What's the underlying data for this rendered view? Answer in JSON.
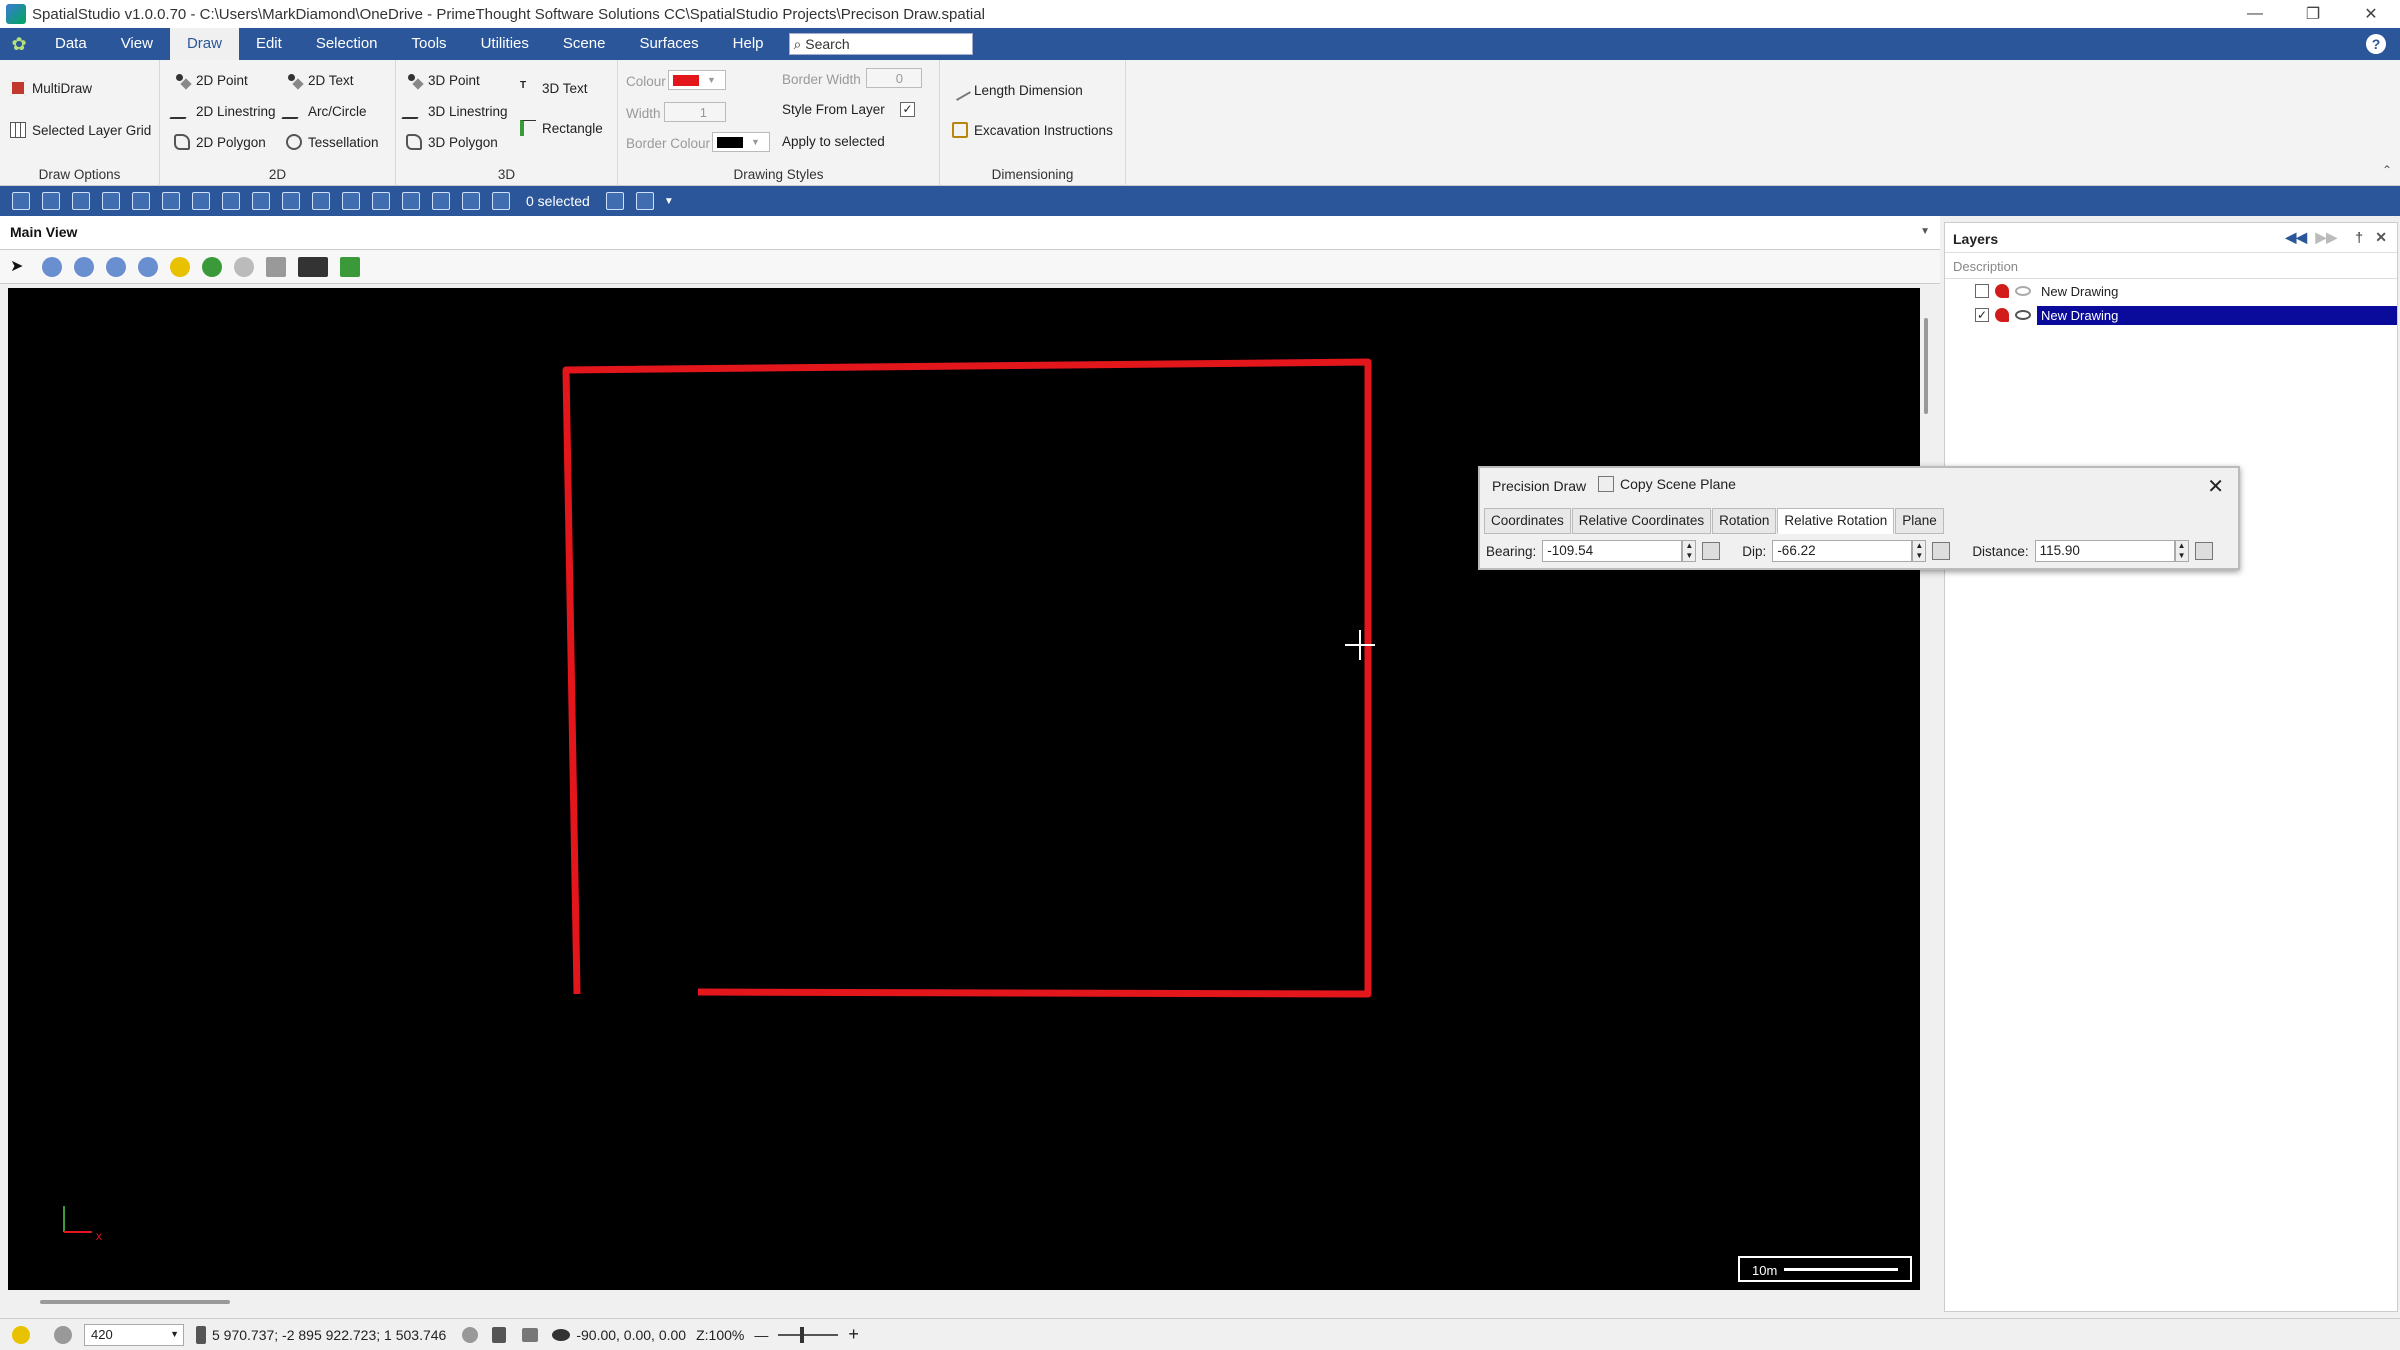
{
  "window": {
    "title": "SpatialStudio v1.0.0.70 - C:\\Users\\MarkDiamond\\OneDrive - PrimeThought Software Solutions CC\\SpatialStudio Projects\\Precison Draw.spatial"
  },
  "menu": {
    "items": [
      "Data",
      "View",
      "Draw",
      "Edit",
      "Selection",
      "Tools",
      "Utilities",
      "Scene",
      "Surfaces",
      "Help"
    ],
    "active": "Draw",
    "search_placeholder": "Search"
  },
  "ribbon": {
    "draw_options": {
      "label": "Draw Options",
      "multidraw": "MultiDraw",
      "selected_layer_grid": "Selected Layer Grid"
    },
    "group_2d": {
      "label": "2D",
      "point": "2D Point",
      "linestring": "2D Linestring",
      "polygon": "2D Polygon",
      "text": "2D Text",
      "arc": "Arc/Circle",
      "tessellation": "Tessellation"
    },
    "group_3d": {
      "label": "3D",
      "point": "3D Point",
      "linestring": "3D Linestring",
      "polygon": "3D Polygon",
      "text": "3D Text",
      "rectangle": "Rectangle"
    },
    "styles": {
      "label": "Drawing Styles",
      "colour": "Colour",
      "colour_value": "#e3161c",
      "width": "Width",
      "width_value": "1",
      "border_colour": "Border Colour",
      "border_colour_value": "#000000",
      "border_width": "Border Width",
      "border_width_value": "0",
      "style_from_layer": "Style From Layer",
      "apply": "Apply to selected"
    },
    "dimensioning": {
      "label": "Dimensioning",
      "length": "Length Dimension",
      "excavation": "Excavation Instructions"
    }
  },
  "quickbar": {
    "selected": "0 selected"
  },
  "main_view": {
    "title": "Main View",
    "scale_label": "10m",
    "axis_x": "x"
  },
  "layers": {
    "title": "Layers",
    "column": "Description",
    "items": [
      {
        "name": "New Drawing",
        "checked": false
      },
      {
        "name": "New Drawing",
        "checked": true,
        "selected": true
      }
    ]
  },
  "precision": {
    "title": "Precision Draw",
    "copy": "Copy Scene Plane",
    "tabs": [
      "Coordinates",
      "Relative Coordinates",
      "Rotation",
      "Relative Rotation",
      "Plane"
    ],
    "active_tab": "Relative Rotation",
    "bearing_label": "Bearing:",
    "bearing": "-109.54",
    "dip_label": "Dip:",
    "dip": "-66.22",
    "distance_label": "Distance:",
    "distance": "115.90"
  },
  "status": {
    "zoom_value": "420",
    "coords": "5 970.737; -2 895 922.723; 1 503.746",
    "view": "-90.00, 0.00, 0.00",
    "zoom": "Z:100%"
  }
}
